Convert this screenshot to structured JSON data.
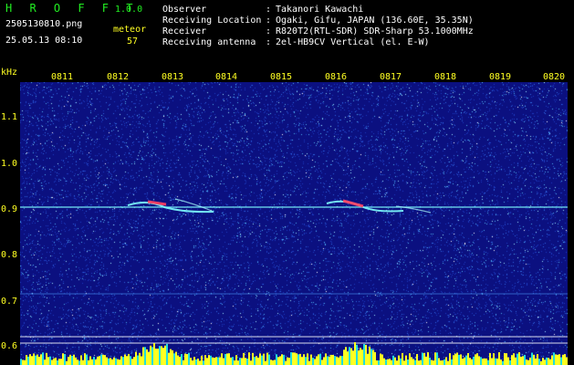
{
  "app": {
    "name": "H R O F F T",
    "version": "1.0.0"
  },
  "file": {
    "name": "2505130810.png",
    "datetime": "25.05.13 08:10"
  },
  "meteor": {
    "label": "meteor",
    "count": "57"
  },
  "info": [
    {
      "label": "Observer",
      "value": "Takanori Kawachi"
    },
    {
      "label": "Receiving Location",
      "value": "Ogaki, Gifu, JAPAN (136.60E, 35.35N)"
    },
    {
      "label": "Receiver",
      "value": "R820T2(RTL-SDR) SDR-Sharp 53.1000MHz"
    },
    {
      "label": "Receiving antenna",
      "value": "2el-HB9CV Vertical (el. E-W)"
    }
  ],
  "axis": {
    "unit": "kHz",
    "time_ticks": [
      "0811",
      "0812",
      "0813",
      "0814",
      "0815",
      "0816",
      "0817",
      "0818",
      "0819",
      "0820"
    ],
    "freq_ticks": [
      "1.1",
      "1.0",
      "0.9",
      "0.8",
      "0.7",
      "0.6"
    ]
  },
  "colors": {
    "background": "#000000",
    "spectrogram_base": "#0b1080",
    "label_green": "#22ee22",
    "label_yellow": "#ffff22",
    "signal_cyan": "#7fffff",
    "meteor_red": "#ff4060"
  }
}
